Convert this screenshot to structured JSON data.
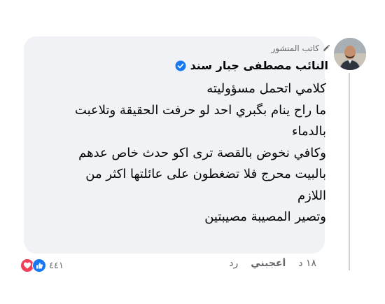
{
  "comment": {
    "author_badge": "كاتب المنشور",
    "author_name": "النائب مصطفى جبار سند",
    "lines": [
      "كلامي اتحمل مسؤوليته",
      "ما راح ينام بگبري احد لو حرفت الحقيقة وتلاعبت",
      "بالدماء",
      "وكافي نخوض بالقصة ترى اكو حدث خاص عدهم",
      "بالبيت محرج فلا تضغطون على عائلتها اكثر من",
      "اللازم",
      "وتصير المصيبة مصيبتين"
    ],
    "reaction_count": "٤٤١",
    "time": "١٨ د",
    "like_label": "أعجبني",
    "reply_label": "رد"
  },
  "colors": {
    "bubble": "#f0f2f5",
    "verified": "#1877f2",
    "love": "#f33e58",
    "like": "#1877f2"
  }
}
